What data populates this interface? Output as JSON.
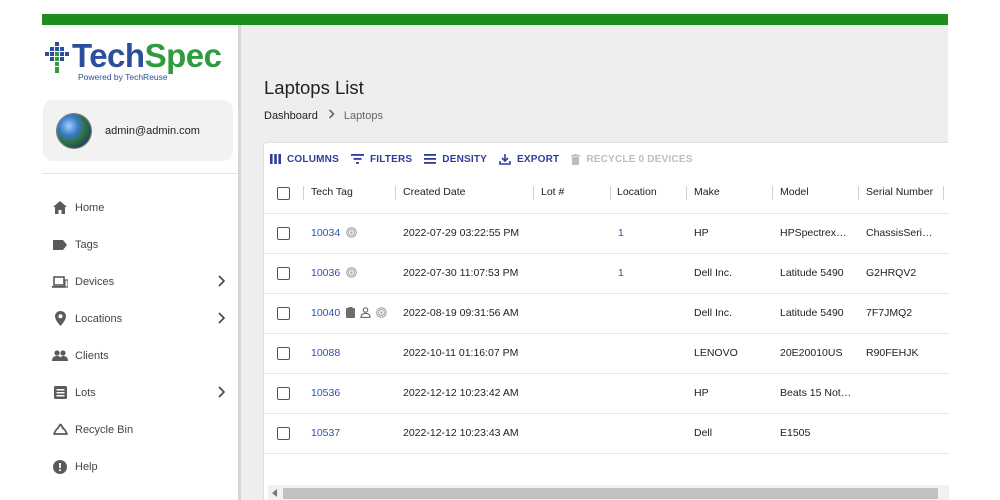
{
  "brand": {
    "name_part1": "Tech",
    "name_part2": "Spec",
    "tagline": "Powered by TechReuse"
  },
  "user": {
    "email": "admin@admin.com"
  },
  "sidebar": {
    "items": [
      {
        "label": "Home",
        "icon": "home-icon",
        "has_submenu": false
      },
      {
        "label": "Tags",
        "icon": "tag-icon",
        "has_submenu": false
      },
      {
        "label": "Devices",
        "icon": "laptop-icon",
        "has_submenu": true
      },
      {
        "label": "Locations",
        "icon": "location-pin-icon",
        "has_submenu": true
      },
      {
        "label": "Clients",
        "icon": "people-icon",
        "has_submenu": false
      },
      {
        "label": "Lots",
        "icon": "list-icon",
        "has_submenu": true
      },
      {
        "label": "Recycle Bin",
        "icon": "recycle-icon",
        "has_submenu": false
      },
      {
        "label": "Help",
        "icon": "help-icon",
        "has_submenu": false
      }
    ]
  },
  "page": {
    "title": "Laptops List",
    "breadcrumb": {
      "parent": "Dashboard",
      "current": "Laptops"
    }
  },
  "toolbar": {
    "columns": "COLUMNS",
    "filters": "FILTERS",
    "density": "DENSITY",
    "export": "EXPORT",
    "recycle": "RECYCLE 0 DEVICES"
  },
  "table": {
    "headers": {
      "tech_tag": "Tech Tag",
      "created_date": "Created Date",
      "lot": "Lot #",
      "location": "Location",
      "make": "Make",
      "model": "Model",
      "serial": "Serial Number"
    },
    "rows": [
      {
        "tech_tag": "10034",
        "created_date": "2022-07-29 03:22:55 PM",
        "lot": "",
        "location": "1",
        "make": "HP",
        "model": "HPSpectrex…",
        "serial": "ChassisSeri…",
        "icons": [
          "fingerprint-icon"
        ]
      },
      {
        "tech_tag": "10036",
        "created_date": "2022-07-30 11:07:53 PM",
        "lot": "",
        "location": "1",
        "make": "Dell Inc.",
        "model": "Latitude 5490",
        "serial": "G2HRQV2",
        "icons": [
          "fingerprint-icon"
        ]
      },
      {
        "tech_tag": "10040",
        "created_date": "2022-08-19 09:31:56 AM",
        "lot": "",
        "location": "",
        "make": "Dell Inc.",
        "model": "Latitude 5490",
        "serial": "7F7JMQ2",
        "icons": [
          "clipboard-icon",
          "person-icon",
          "fingerprint-icon"
        ]
      },
      {
        "tech_tag": "10088",
        "created_date": "2022-10-11 01:16:07 PM",
        "lot": "",
        "location": "",
        "make": "LENOVO",
        "model": "20E20010US",
        "serial": "R90FEHJK",
        "icons": []
      },
      {
        "tech_tag": "10536",
        "created_date": "2022-12-12 10:23:42 AM",
        "lot": "",
        "location": "",
        "make": "HP",
        "model": "Beats 15 Not…",
        "serial": "",
        "icons": []
      },
      {
        "tech_tag": "10537",
        "created_date": "2022-12-12 10:23:43 AM",
        "lot": "",
        "location": "",
        "make": "Dell",
        "model": "E1505",
        "serial": "",
        "icons": []
      }
    ]
  },
  "colors": {
    "top_bar": "#1e8c1e",
    "brand_blue": "#2b4f9a",
    "brand_green": "#2e9c3e",
    "accent": "#2e3d9a",
    "link": "#2e4fb0"
  }
}
